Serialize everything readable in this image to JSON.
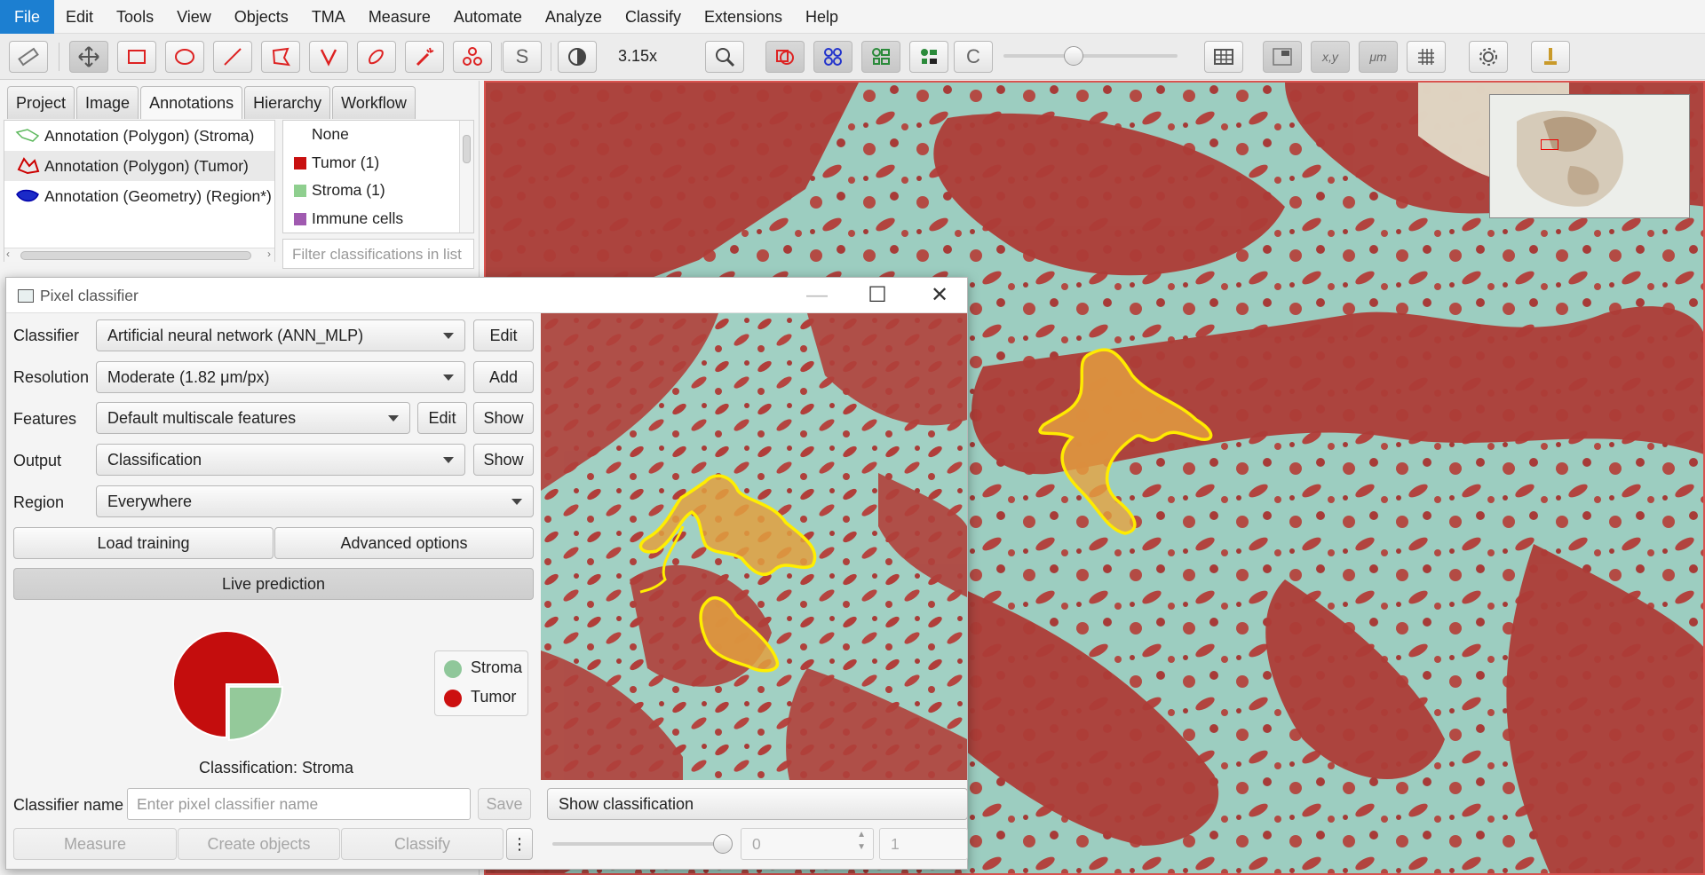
{
  "menu": [
    "File",
    "Edit",
    "Tools",
    "View",
    "Objects",
    "TMA",
    "Measure",
    "Automate",
    "Analyze",
    "Classify",
    "Extensions",
    "Help"
  ],
  "toolbar": {
    "zoom": "3.15x",
    "toggle_s": "S",
    "toggle_c": "C",
    "xy_label": "x,y",
    "um_label": "μm"
  },
  "tabs": [
    "Project",
    "Image",
    "Annotations",
    "Hierarchy",
    "Workflow"
  ],
  "annotations": [
    {
      "label": "Annotation (Polygon) (Stroma)",
      "color": "#5cb85c"
    },
    {
      "label": "Annotation (Polygon) (Tumor)",
      "color": "#cc0000"
    },
    {
      "label": "Annotation (Geometry) (Region*)",
      "color": "#0000aa"
    }
  ],
  "classes": [
    {
      "label": "None",
      "color": ""
    },
    {
      "label": "Tumor (1)",
      "color": "#c81010"
    },
    {
      "label": "Stroma (1)",
      "color": "#8fcf8f"
    },
    {
      "label": "Immune cells",
      "color": "#a05ab0"
    }
  ],
  "class_filter_placeholder": "Filter classifications in list",
  "dialog": {
    "title": "Pixel classifier",
    "classifier_label": "Classifier",
    "classifier_value": "Artificial neural network (ANN_MLP)",
    "resolution_label": "Resolution",
    "resolution_value": "Moderate (1.82 μm/px)",
    "features_label": "Features",
    "features_value": "Default multiscale features",
    "output_label": "Output",
    "output_value": "Classification",
    "region_label": "Region",
    "region_value": "Everywhere",
    "edit_label": "Edit",
    "add_label": "Add",
    "show_label": "Show",
    "load_training": "Load training",
    "advanced_options": "Advanced options",
    "live_prediction": "Live prediction",
    "pie": {
      "tumor_fraction": 0.75,
      "stroma_fraction": 0.25,
      "tumor_color": "#c40d0d",
      "stroma_color": "#94c99a"
    },
    "legend": [
      {
        "label": "Stroma",
        "color": "#8fc79a"
      },
      {
        "label": "Tumor",
        "color": "#cc1010"
      }
    ],
    "classification_text": "Classification: Stroma",
    "classifier_name_label": "Classifier name",
    "classifier_name_placeholder": "Enter pixel classifier name",
    "save": "Save",
    "measure": "Measure",
    "create_objects": "Create objects",
    "classify": "Classify",
    "more": "⋮",
    "show_classification": "Show classification",
    "spinner_a": "0",
    "spinner_b": "1"
  }
}
